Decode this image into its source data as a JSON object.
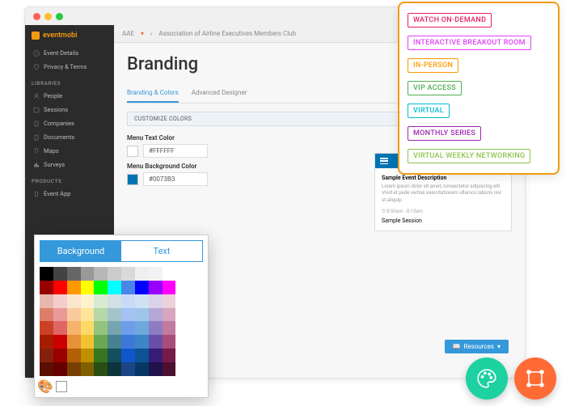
{
  "brand": "eventmobi",
  "crumbs": {
    "space": "AAE",
    "org": "Association of Airline Executives Members Club"
  },
  "sidebar": {
    "top": [
      {
        "icon": "info",
        "label": "Event Details"
      },
      {
        "icon": "shield",
        "label": "Privacy & Terms"
      }
    ],
    "section1": "LIBRARIES",
    "libs": [
      {
        "icon": "people",
        "label": "People"
      },
      {
        "icon": "calendar",
        "label": "Sessions"
      },
      {
        "icon": "building",
        "label": "Companies"
      },
      {
        "icon": "doc",
        "label": "Documents"
      },
      {
        "icon": "map",
        "label": "Maps"
      },
      {
        "icon": "survey",
        "label": "Surveys"
      }
    ],
    "section2": "PRODUCTS",
    "products": [
      {
        "icon": "app",
        "label": "Event App"
      }
    ]
  },
  "page": {
    "title": "Branding",
    "tabs": [
      "Branding & Colors",
      "Advanced Designer"
    ],
    "panel_title": "CUSTOMIZE COLORS",
    "fields": [
      {
        "label": "Menu Text Color",
        "hex": "#FFFFFF"
      },
      {
        "label": "Menu Background Color",
        "hex": "#0073B3"
      }
    ]
  },
  "preview": {
    "title": "Sample Event Description",
    "lorem": "Lorem ipsum dolor sit amet, consectetur adipiscing elit. Vivid et pede veritas exercitationem ullamco laboris nisi ut aliquip.",
    "time": "8:00am - 8:15am",
    "session": "Sample Session"
  },
  "resources": "Resources",
  "tags": [
    {
      "text": "WATCH ON-DEMAND",
      "color": "#e91e63"
    },
    {
      "text": "INTERACTIVE BREAKOUT ROOM",
      "color": "#e040fb"
    },
    {
      "text": "IN-PERSON",
      "color": "#ff9800"
    },
    {
      "text": "VIP ACCESS",
      "color": "#4caf50"
    },
    {
      "text": "VIRTUAL",
      "color": "#00bcd4"
    },
    {
      "text": "MONTHLY SERIES",
      "color": "#9c27b0"
    },
    {
      "text": "VIRTUAL WEEKLY NETWORKING",
      "color": "#8bc34a"
    }
  ],
  "picker": {
    "tabs": [
      "Background",
      "Text"
    ],
    "colors": [
      "#000000",
      "#434343",
      "#666666",
      "#999999",
      "#b7b7b7",
      "#cccccc",
      "#d9d9d9",
      "#efefef",
      "#f3f3f3",
      "#ffffff",
      "#ffffff",
      "#ffffff",
      "#980000",
      "#ff0000",
      "#ff9900",
      "#ffff00",
      "#00ff00",
      "#00ffff",
      "#4a86e8",
      "#0000ff",
      "#9900ff",
      "#ff00ff",
      "#ffffff",
      "#ffffff",
      "#e6b8af",
      "#f4cccc",
      "#fce5cd",
      "#fff2cc",
      "#d9ead3",
      "#d0e0e3",
      "#c9daf8",
      "#cfe2f3",
      "#d9d2e9",
      "#ead1dc",
      "#ffffff",
      "#ffffff",
      "#dd7e6b",
      "#ea9999",
      "#f9cb9c",
      "#ffe599",
      "#b6d7a8",
      "#a2c4c9",
      "#a4c2f4",
      "#9fc5e8",
      "#b4a7d6",
      "#d5a6bd",
      "#ffffff",
      "#ffffff",
      "#cc4125",
      "#e06666",
      "#f6b26b",
      "#ffd966",
      "#93c47d",
      "#76a5af",
      "#6d9eeb",
      "#6fa8dc",
      "#8e7cc3",
      "#c27ba0",
      "#ffffff",
      "#ffffff",
      "#a61c00",
      "#cc0000",
      "#e69138",
      "#f1c232",
      "#6aa84f",
      "#45818e",
      "#3c78d8",
      "#3d85c6",
      "#674ea7",
      "#a64d79",
      "#ffffff",
      "#ffffff",
      "#85200c",
      "#990000",
      "#b45f06",
      "#bf9000",
      "#38761d",
      "#134f5c",
      "#1155cc",
      "#0b5394",
      "#351c75",
      "#741b47",
      "#ffffff",
      "#ffffff",
      "#5b0f00",
      "#660000",
      "#783f04",
      "#7f6000",
      "#274e13",
      "#0c343d",
      "#1c4587",
      "#073763",
      "#20124d",
      "#4c1130",
      "#ffffff",
      "#ffffff"
    ]
  }
}
